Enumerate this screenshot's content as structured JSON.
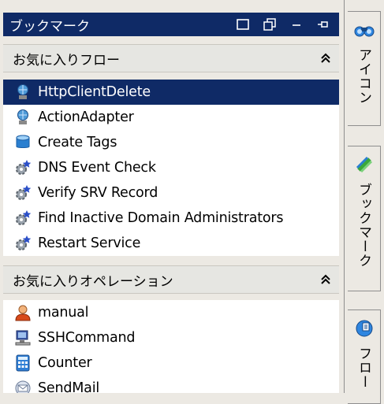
{
  "panel": {
    "title": "ブックマーク",
    "controls": {
      "restore_glyph": "□",
      "float_glyph": "⧉",
      "minimize_glyph": "–",
      "pin_glyph": "⊣"
    }
  },
  "favorites_flow": {
    "header": "お気に入りフロー",
    "items": [
      {
        "label": "HttpClientDelete",
        "icon": "globe-person-icon",
        "selected": true
      },
      {
        "label": "ActionAdapter",
        "icon": "globe-person-icon",
        "selected": false
      },
      {
        "label": "Create Tags",
        "icon": "database-icon",
        "selected": false
      },
      {
        "label": "DNS Event Check",
        "icon": "gear-star-icon",
        "selected": false
      },
      {
        "label": "Verify SRV Record",
        "icon": "gear-star-icon",
        "selected": false
      },
      {
        "label": "Find Inactive Domain Administrators",
        "icon": "gear-star-icon",
        "selected": false
      },
      {
        "label": "Restart Service",
        "icon": "gear-star-icon",
        "selected": false
      }
    ]
  },
  "favorites_operation": {
    "header": "お気に入りオペレーション",
    "items": [
      {
        "label": "manual",
        "icon": "user-icon"
      },
      {
        "label": "SSHCommand",
        "icon": "computer-icon"
      },
      {
        "label": "Counter",
        "icon": "calculator-icon"
      },
      {
        "label": "SendMail",
        "icon": "mail-icon"
      }
    ]
  },
  "side_tabs": [
    {
      "label": "アイコン",
      "icon": "binoculars-icon"
    },
    {
      "label": "ブックマーク",
      "icon": "bookmark-icon"
    },
    {
      "label": "フロー",
      "icon": "flow-icon"
    }
  ],
  "colors": {
    "title_bar": "#0f2a66",
    "selected_row": "#0f2a66",
    "panel_bg": "#ece9e3"
  }
}
